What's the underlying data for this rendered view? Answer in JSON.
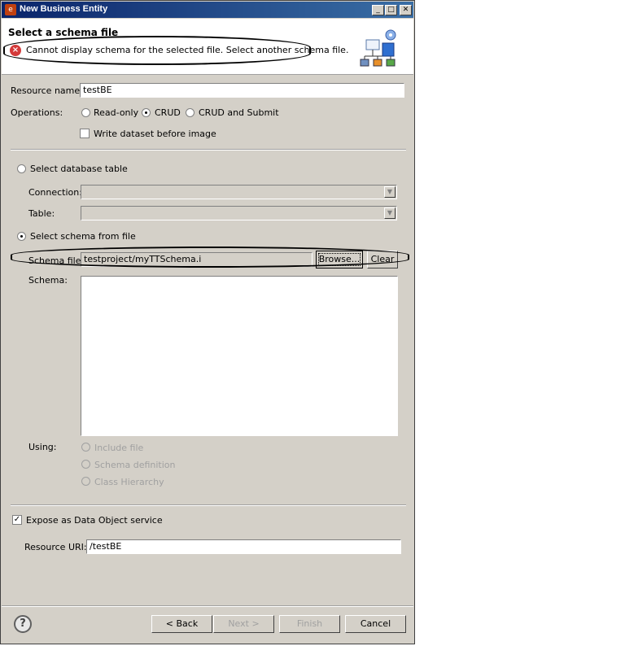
{
  "window": {
    "title": "New Business Entity",
    "app_icon": "eclipse-icon",
    "controls": [
      "minimize-icon",
      "maximize-icon",
      "close-icon"
    ]
  },
  "banner": {
    "title": "Select a schema file",
    "error_message": "Cannot display schema for the selected file. Select another schema file.",
    "error_icon": "error-icon",
    "wizard_icon": "schema-diagram-icon"
  },
  "resource_name": {
    "label": "Resource name:",
    "value": "testBE"
  },
  "operations": {
    "label": "Operations:",
    "options": [
      "Read-only",
      "CRUD",
      "CRUD and Submit"
    ],
    "selected": "CRUD",
    "write_dataset_label": "Write dataset before image",
    "write_dataset_checked": false
  },
  "database": {
    "radio_label": "Select database table",
    "connection_label": "Connection:",
    "table_label": "Table:"
  },
  "schema": {
    "radio_label": "Select schema from file",
    "file_label": "Schema file:",
    "file_value": "testproject/myTTSchema.i",
    "browse_label": "Browse...",
    "clear_label": "Clear",
    "schema_label": "Schema:"
  },
  "using": {
    "label": "Using:",
    "options": [
      "Include file",
      "Schema definition",
      "Class Hierarchy"
    ]
  },
  "expose": {
    "label": "Expose as Data Object service",
    "checked": true,
    "uri_label": "Resource URI:",
    "uri_value": "/testBE"
  },
  "buttons": {
    "back": "< Back",
    "next": "Next >",
    "finish": "Finish",
    "cancel": "Cancel"
  }
}
